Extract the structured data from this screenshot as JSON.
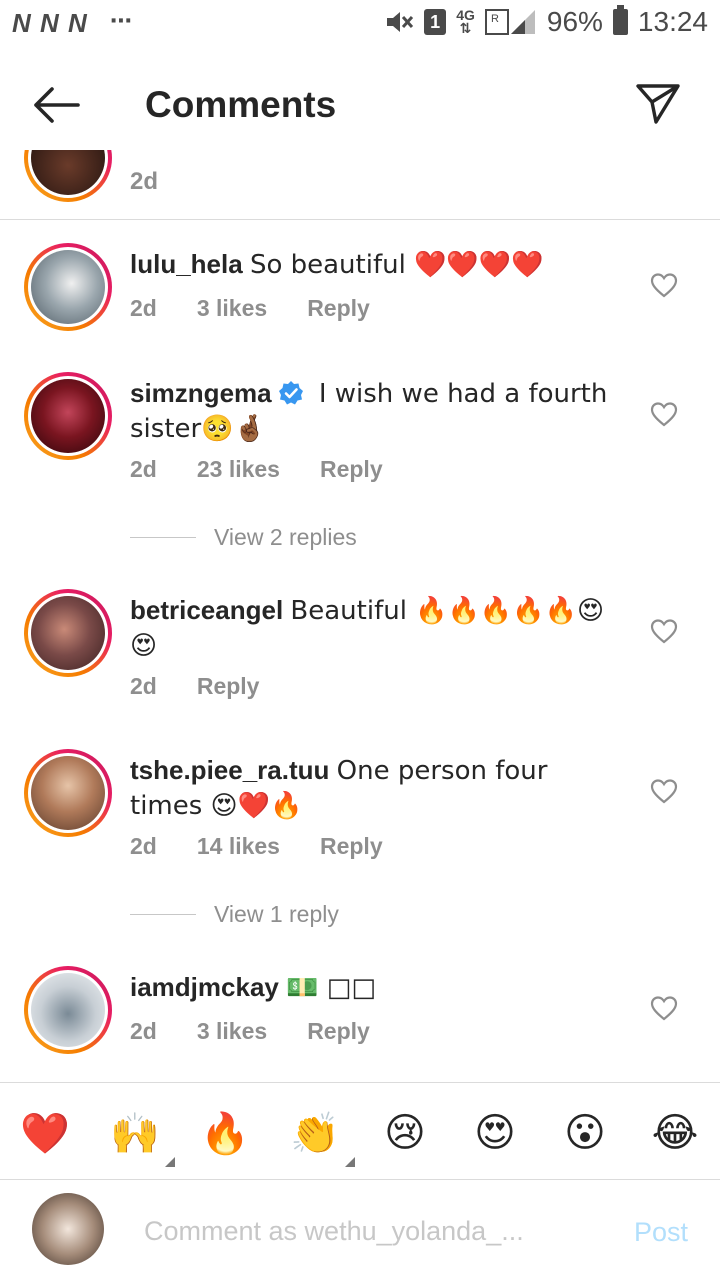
{
  "status": {
    "left_icons": "N N N",
    "more": "⋯",
    "sim": "1",
    "network": "4G",
    "battery": "96%",
    "time": "13:24"
  },
  "header": {
    "title": "Comments"
  },
  "caption": {
    "time": "2d"
  },
  "comments": [
    {
      "user": "lulu_hela",
      "text": "So beautiful ❤️❤️❤️❤️",
      "time": "2d",
      "likes": "3 likes",
      "reply": "Reply",
      "avatar_color": "#8a9ba8"
    },
    {
      "user": "simzngema",
      "verified": true,
      "text": "I wish we had a fourth sister🥺🤞🏾",
      "time": "2d",
      "likes": "23 likes",
      "reply": "Reply",
      "view_replies": "View 2 replies",
      "avatar_color": "#7a1520"
    },
    {
      "user": "betriceangel",
      "text": "Beautiful 🔥🔥🔥🔥🔥😍😍",
      "time": "2d",
      "likes": "",
      "reply": "Reply",
      "avatar_color": "#6a4a3e"
    },
    {
      "user": "tshe.piee_ra.tuu",
      "text": "One person four times 😍❤️🔥",
      "time": "2d",
      "likes": "14 likes",
      "reply": "Reply",
      "view_replies": "View 1 reply",
      "avatar_color": "#b07a5a"
    },
    {
      "user": "iamdjmckay",
      "text": "💵 □□",
      "time": "2d",
      "likes": "3 likes",
      "reply": "Reply",
      "avatar_color": "#d8dde2"
    }
  ],
  "quick_emojis": [
    "❤️",
    "🙌",
    "🔥",
    "👏",
    "😢",
    "😍",
    "😮",
    "😂"
  ],
  "composer": {
    "placeholder": "Comment as wethu_yolanda_...",
    "post_label": "Post"
  },
  "colors": {
    "accent_blue": "#3897f0",
    "post_disabled": "#b2dffc",
    "meta_gray": "#8e8e8e"
  }
}
